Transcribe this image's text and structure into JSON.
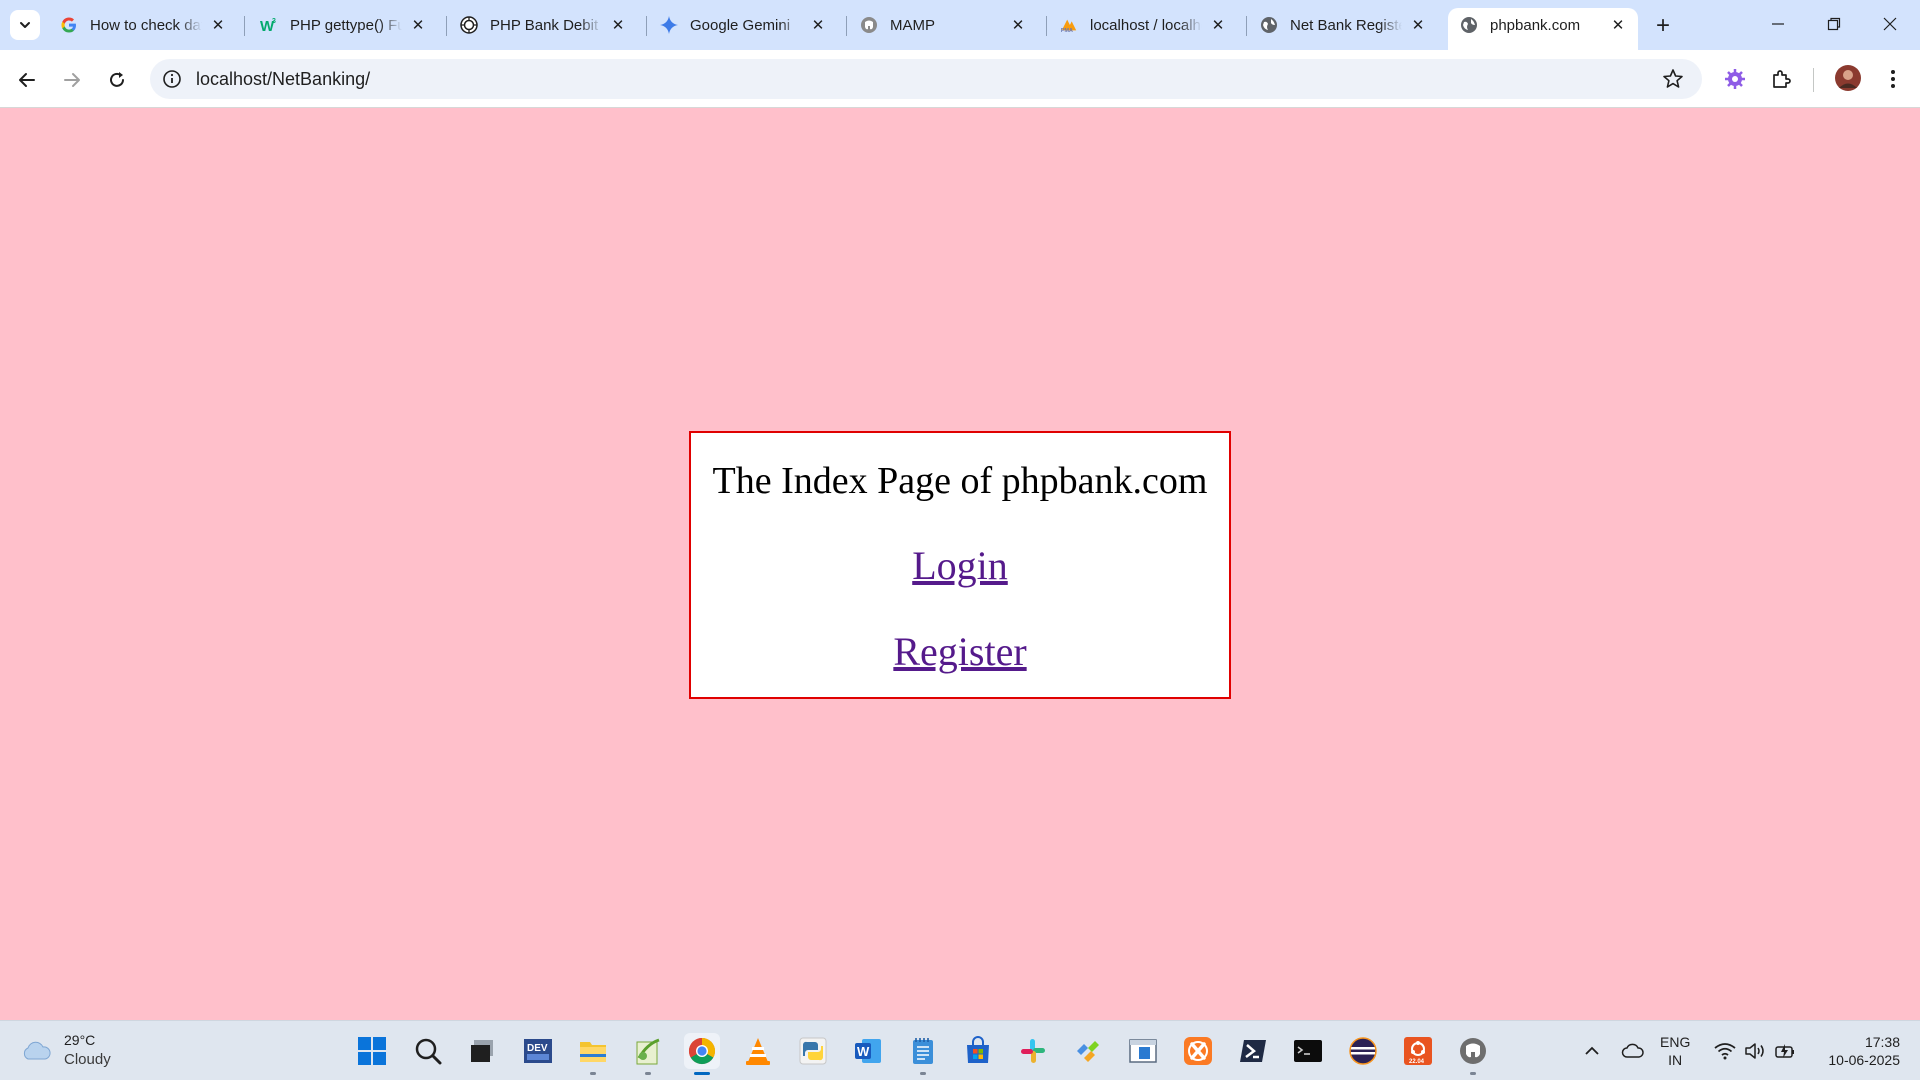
{
  "browser": {
    "tabs": [
      {
        "title": "How to check data type in PHP",
        "icon": "google-g-icon"
      },
      {
        "title": "PHP gettype() Function",
        "icon": "w3schools-icon"
      },
      {
        "title": "PHP Bank Debit System",
        "icon": "chatgpt-icon"
      },
      {
        "title": "Google Gemini",
        "icon": "gemini-sparkle-icon"
      },
      {
        "title": "MAMP",
        "icon": "mamp-elephant-icon"
      },
      {
        "title": "localhost / localhost",
        "icon": "phpmyadmin-icon"
      },
      {
        "title": "Net Bank Register",
        "icon": "globe-icon"
      },
      {
        "title": "phpbank.com",
        "icon": "globe-icon",
        "active": true
      }
    ],
    "address_bar": {
      "url": "localhost/NetBanking/"
    }
  },
  "page": {
    "heading": "The Index Page of phpbank.com",
    "links": [
      {
        "label": "Login"
      },
      {
        "label": "Register"
      }
    ],
    "colors": {
      "background": "#ffc0cb",
      "card_border": "#e00000",
      "link": "#551a8b"
    }
  },
  "taskbar": {
    "weather": {
      "temp": "29°C",
      "condition": "Cloudy"
    },
    "apps": [
      "start-icon",
      "search-icon",
      "task-view-icon",
      "devc-icon",
      "file-explorer-icon",
      "notepad-plus-icon",
      "chrome-icon",
      "vlc-icon",
      "python-icon",
      "word-icon",
      "notepad-icon",
      "microsoft-store-icon",
      "slack-icon",
      "tool-icon",
      "window-app-icon",
      "xampp-icon",
      "powershell-icon",
      "terminal-icon",
      "eclipse-icon",
      "ubuntu-icon",
      "mamp-icon"
    ],
    "language": {
      "line1": "ENG",
      "line2": "IN"
    },
    "clock": {
      "time": "17:38",
      "date": "10-06-2025"
    }
  }
}
